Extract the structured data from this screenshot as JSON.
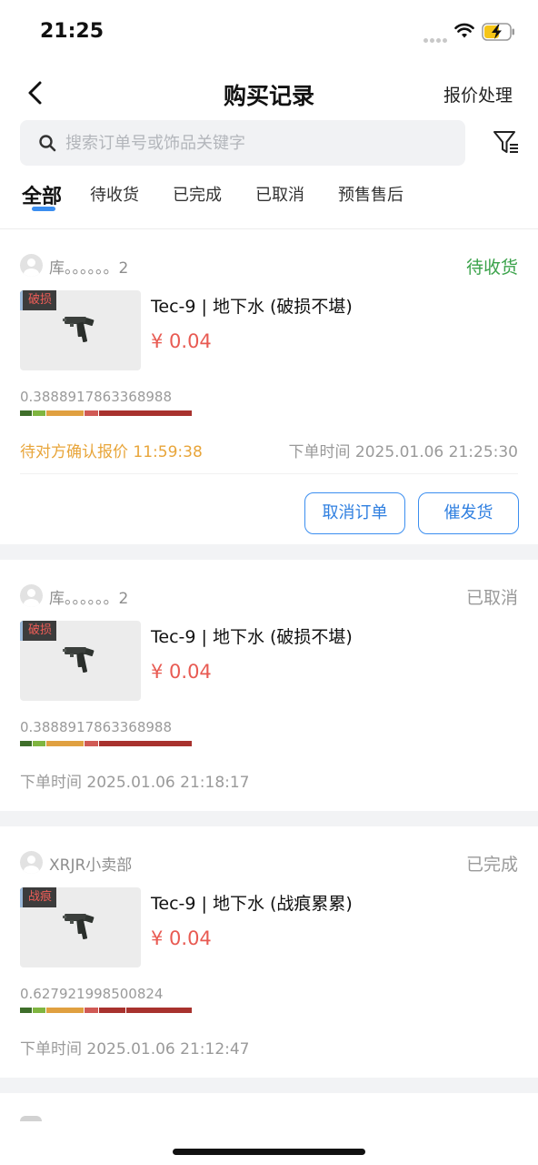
{
  "status_bar": {
    "time": "21:25"
  },
  "nav": {
    "title": "购买记录",
    "right_action": "报价处理"
  },
  "search": {
    "placeholder": "搜索订单号或饰品关键字",
    "value": ""
  },
  "tabs": [
    {
      "label": "全部",
      "active": true
    },
    {
      "label": "待收货",
      "active": false
    },
    {
      "label": "已完成",
      "active": false
    },
    {
      "label": "已取消",
      "active": false
    },
    {
      "label": "预售售后",
      "active": false
    }
  ],
  "colors": {
    "accent": "#3b8ef0",
    "price": "#e85a52",
    "status_pending": "#3aa24a",
    "status_muted": "#9a9a9a",
    "waiting": "#e8a53a"
  },
  "orders": [
    {
      "seller": "库。。。。。。2",
      "status": "待收货",
      "wear_badge": "破损",
      "item_name": "Tec-9 | 地下水 (破损不堪)",
      "price": "¥ 0.04",
      "float_value": "0.3888917863368988",
      "wait_text": "待对方确认报价 11:59:38",
      "order_time": "下单时间 2025.01.06 21:25:30",
      "buttons": [
        "取消订单",
        "催发货"
      ]
    },
    {
      "seller": "库。。。。。。2",
      "status": "已取消",
      "wear_badge": "破损",
      "item_name": "Tec-9 | 地下水 (破损不堪)",
      "price": "¥ 0.04",
      "float_value": "0.3888917863368988",
      "order_time": "下单时间 2025.01.06 21:18:17"
    },
    {
      "seller": "XRJR小卖部",
      "status": "已完成",
      "wear_badge": "战痕",
      "item_name": "Tec-9 | 地下水 (战痕累累)",
      "price": "¥ 0.04",
      "float_value": "0.627921998500824",
      "order_time": "下单时间 2025.01.06 21:12:47"
    }
  ]
}
